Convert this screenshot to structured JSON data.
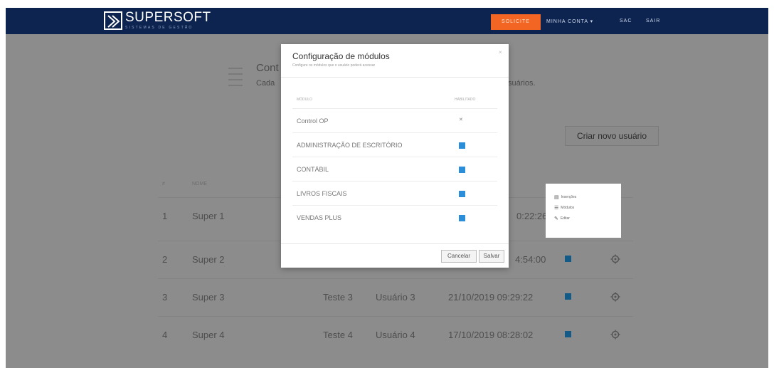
{
  "brand": {
    "name": "SUPERSOFT",
    "tagline": "SISTEMAS DE GESTÃO"
  },
  "nav": {
    "highlight": "SOLICITE",
    "account": "MINHA CONTA ▾",
    "sac": "SAC",
    "logout": "SAIR"
  },
  "page": {
    "title": "Cont",
    "subtitle": "Cada",
    "subtitle_tail": "suários.",
    "create_button": "Criar novo usuário"
  },
  "table": {
    "headers": [
      "#",
      "NOME"
    ],
    "rows": [
      {
        "num": "1",
        "name": "Super 1",
        "c3": "",
        "c4": "",
        "date": "0:22:26"
      },
      {
        "num": "2",
        "name": "Super 2",
        "c3": "",
        "c4": "",
        "date": "4:54:00"
      },
      {
        "num": "3",
        "name": "Super 3",
        "c3": "Teste 3",
        "c4": "Usuário 3",
        "date": "21/10/2019 09:29:22"
      },
      {
        "num": "4",
        "name": "Super 4",
        "c3": "Teste 4",
        "c4": "Usuário 4",
        "date": "17/10/2019 08:28:02"
      }
    ]
  },
  "context_menu": {
    "items": [
      {
        "icon": "▤",
        "label": "Inserções"
      },
      {
        "icon": "☰",
        "label": "Módulos"
      },
      {
        "icon": "✎",
        "label": "Editar"
      }
    ]
  },
  "modal": {
    "title": "Configuração de módulos",
    "subtitle": "Configure os módulos que o usuário poderá acessar",
    "close": "×",
    "col_module": "MÓDULO",
    "col_enabled": "HABILITADO",
    "rows": [
      {
        "label": "Control OP",
        "checked": false,
        "mark": "✕"
      },
      {
        "label": "ADMINISTRAÇÃO DE ESCRITÓRIO",
        "checked": true
      },
      {
        "label": "CONTÁBIL",
        "checked": true
      },
      {
        "label": "LIVROS FISCAIS",
        "checked": true
      },
      {
        "label": "VENDAS PLUS",
        "checked": true
      }
    ],
    "cancel": "Cancelar",
    "save": "Salvar"
  },
  "colors": {
    "topbar": "#0d2450",
    "accent": "#f26522",
    "checkbox": "#2c8ed8",
    "overlay": "#8c8c8c"
  }
}
